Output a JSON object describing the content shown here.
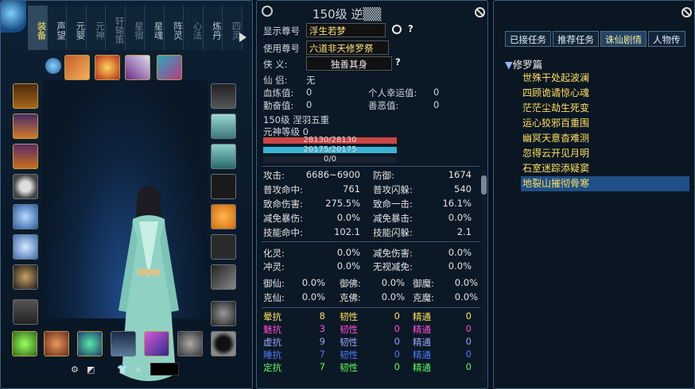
{
  "left_panel": {
    "tabs": [
      {
        "label": "装备",
        "state": "active"
      },
      {
        "label": "声望",
        "state": "normal"
      },
      {
        "label": "元婴",
        "state": "normal"
      },
      {
        "label": "元神",
        "state": "dim"
      },
      {
        "label": "轩辕策",
        "state": "dim"
      },
      {
        "label": "星宿",
        "state": "dim"
      },
      {
        "label": "星魂",
        "state": "normal"
      },
      {
        "label": "阵灵",
        "state": "normal"
      },
      {
        "label": "心法",
        "state": "dim"
      },
      {
        "label": "炼丹",
        "state": "normal"
      },
      {
        "label": "四灵",
        "state": "dim"
      }
    ]
  },
  "middle_panel": {
    "title": "150级 逆▒▒",
    "display_title_label": "显示尊号",
    "display_title_value": "浮生若梦",
    "use_title_label": "使用尊号",
    "use_title_value": "六道非天修罗祭",
    "knight_label": "侠  义:",
    "knight_value": "独善其身",
    "partner_label": "仙  侣:",
    "partner_value": "无",
    "refine_label": "血炼值:",
    "refine_value": "0",
    "luck_label": "个人幸运值:",
    "luck_value": "0",
    "diligence_label": "勤奋值:",
    "diligence_value": "0",
    "goodevil_label": "善恶值:",
    "goodevil_value": "0",
    "level_line": "150级 涅羽五重",
    "spirit_line": "元神等级 0",
    "hp": "28130/28130",
    "mp": "20175/20175",
    "xp": "0/0",
    "stats": [
      {
        "k": "攻击:",
        "v": "6686~6900",
        "k2": "防御:",
        "v2": "1674"
      },
      {
        "k": "普攻命中:",
        "v": "761",
        "k2": "普攻闪躲:",
        "v2": "540"
      },
      {
        "k": "致命伤害:",
        "v": "275.5%",
        "k2": "致命一击:",
        "v2": "16.1%"
      },
      {
        "k": "减免暴伤:",
        "v": "0.0%",
        "k2": "减免暴击:",
        "v2": "0.0%"
      },
      {
        "k": "技能命中:",
        "v": "102.1",
        "k2": "技能闪躲:",
        "v2": "2.1"
      }
    ],
    "stats2": [
      {
        "k": "化灵:",
        "v": "0.0%",
        "k2": "减免伤害:",
        "v2": "0.0%"
      },
      {
        "k": "冲灵:",
        "v": "0.0%",
        "k2": "无视减免:",
        "v2": "0.0%"
      }
    ],
    "stats3": [
      {
        "a": "御仙:",
        "av": "0.0%",
        "b": "御佛:",
        "bv": "0.0%",
        "c": "御魔:",
        "cv": "0.0%"
      },
      {
        "a": "克仙:",
        "av": "0.0%",
        "b": "克佛:",
        "bv": "0.0%",
        "c": "克魔:",
        "cv": "0.0%"
      }
    ],
    "resist": [
      {
        "a": "晕抗",
        "av": "8",
        "b": "韧性",
        "bv": "0",
        "c": "精通",
        "cv": "0",
        "color": "#ffe35a"
      },
      {
        "a": "魅抗",
        "av": "3",
        "b": "韧性",
        "bv": "0",
        "c": "精通",
        "cv": "0",
        "color": "#ff4fd2"
      },
      {
        "a": "虚抗",
        "av": "9",
        "b": "韧性",
        "bv": "0",
        "c": "精通",
        "cv": "0",
        "color": "#9aa8ff"
      },
      {
        "a": "睡抗",
        "av": "7",
        "b": "韧性",
        "bv": "0",
        "c": "精通",
        "cv": "0",
        "color": "#4a7cff"
      },
      {
        "a": "定抗",
        "av": "7",
        "b": "韧性",
        "bv": "0",
        "c": "精通",
        "cv": "0",
        "color": "#5cff5c"
      }
    ]
  },
  "right_panel": {
    "tabs": [
      {
        "label": "已接任务",
        "active": false
      },
      {
        "label": "推荐任务",
        "active": false
      },
      {
        "label": "诛仙剧情",
        "active": true
      },
      {
        "label": "人物传",
        "active": false
      }
    ],
    "chapter": "修罗篇",
    "quests": [
      "世殊干处起波澜",
      "四顾诡谲惊心魂",
      "茫茫尘劫生死变",
      "运心狡邪百重围",
      "幽冥天意杳难测",
      "忽得云开见月明",
      "石室迷踪添疑窦",
      "地裂山摧彻骨寒"
    ],
    "selected_index": 7
  },
  "colors": {
    "accent": "#ffe35a",
    "hp": "#d44a4a",
    "mp": "#3fb8d8",
    "border": "#3c5f80"
  }
}
